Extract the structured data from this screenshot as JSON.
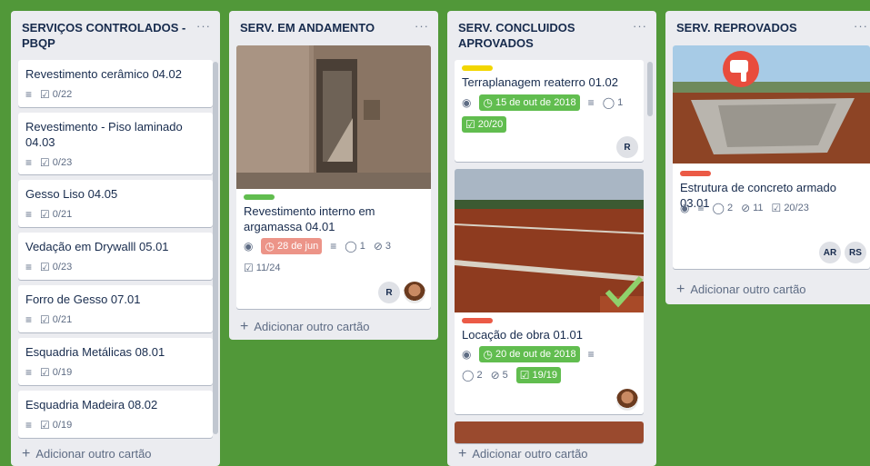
{
  "lists": [
    {
      "title": "SERVIÇOS CONTROLADOS - PBQP",
      "menu": "···",
      "add_label": "Adicionar outro cartão",
      "cards": [
        {
          "title": "Revestimento cerâmico 04.02",
          "checklist": "0/22"
        },
        {
          "title": "Revestimento - Piso laminado 04.03",
          "checklist": "0/23"
        },
        {
          "title": "Gesso Liso 04.05",
          "checklist": "0/21"
        },
        {
          "title": "Vedação em Drywalll 05.01",
          "checklist": "0/23"
        },
        {
          "title": "Forro de Gesso 07.01",
          "checklist": "0/21"
        },
        {
          "title": "Esquadria Metálicas 08.01",
          "checklist": "0/19"
        },
        {
          "title": "Esquadria Madeira 08.02",
          "checklist": "0/19"
        }
      ]
    },
    {
      "title": "SERV. EM ANDAMENTO",
      "menu": "···",
      "add_label": "Adicionar outro cartão",
      "cards": [
        {
          "title": "Revestimento interno em argamassa 04.01",
          "due": "28 de jun",
          "comments": "1",
          "attachments": "3",
          "checklist": "11/24",
          "avatar_initials": "R"
        }
      ]
    },
    {
      "title": "SERV. CONCLUIDOS APROVADOS",
      "menu": "···",
      "add_label": "Adicionar outro cartão",
      "cards": [
        {
          "title": "Terraplanagem reaterro 01.02",
          "due": "15 de out de 2018",
          "comments": "1",
          "checklist": "20/20",
          "avatar_initials": "R"
        },
        {
          "title": "Locação de obra 01.01",
          "due": "20 de out de 2018",
          "comments": "2",
          "attachments": "5",
          "checklist": "19/19"
        }
      ]
    },
    {
      "title": "SERV. REPROVADOS",
      "menu": "···",
      "add_label": "Adicionar outro cartão",
      "cards": [
        {
          "title": "Estrutura de concreto armado 03.01",
          "comments": "2",
          "attachments": "11",
          "checklist": "20/23",
          "avatar_initials_1": "AR",
          "avatar_initials_2": "RS"
        }
      ]
    }
  ],
  "icons": {
    "description": "≡",
    "checklist": "☑",
    "watch": "◉",
    "comment": "◯",
    "attachment": "⊘",
    "clock": "◷",
    "plus": "+"
  },
  "colors": {
    "board_bg": "#519839",
    "list_bg": "#ebecf0",
    "label_green": "#61bd4f",
    "label_yellow": "#f2d600",
    "label_red": "#eb5a46",
    "due_overdue": "#ec9488"
  }
}
